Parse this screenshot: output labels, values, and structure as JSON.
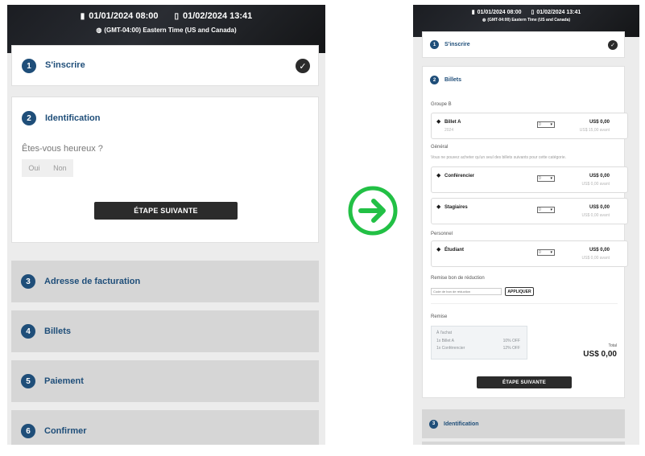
{
  "left": {
    "header": {
      "start_date": "01/01/2024 08:00",
      "end_date": "01/02/2024 13:41",
      "timezone": "(GMT-04:00) Eastern Time (US and Canada)"
    },
    "step1": {
      "number": "1",
      "title": "S'inscrire"
    },
    "step2": {
      "number": "2",
      "title": "Identification",
      "question": "Êtes-vous heureux ?",
      "option_yes": "Oui",
      "option_no": "Non",
      "next_button": "ÉTAPE SUIVANTE"
    },
    "collapsed_steps": [
      {
        "number": "3",
        "title": "Adresse de facturation"
      },
      {
        "number": "4",
        "title": "Billets"
      },
      {
        "number": "5",
        "title": "Paiement"
      },
      {
        "number": "6",
        "title": "Confirmer"
      }
    ]
  },
  "right": {
    "header": {
      "start_date": "01/01/2024 08:00",
      "end_date": "01/02/2024 13:41",
      "timezone": "(GMT-04:00) Eastern Time (US and Canada)"
    },
    "step1": {
      "number": "1",
      "title": "S'inscrire"
    },
    "step2": {
      "number": "2",
      "title": "Billets",
      "group_b": "Groupe B",
      "general": "Général",
      "general_note": "Vous ne pouvez acheter qu'un seul des billets suivants pour cette catégorie.",
      "personnel": "Personnel",
      "tickets": [
        {
          "name": "Billet A",
          "sub": "2024",
          "qty": "0",
          "price": "US$ 0,00",
          "price_sub": "US$ 15,00 avant"
        },
        {
          "name": "Conférencier",
          "sub": "",
          "qty": "0",
          "price": "US$ 0,00",
          "price_sub": "US$ 0,00 avant"
        },
        {
          "name": "Stagiaires",
          "sub": "",
          "qty": "0",
          "price": "US$ 0,00",
          "price_sub": "US$ 0,00 avant"
        },
        {
          "name": "Étudiant",
          "sub": "",
          "qty": "0",
          "price": "US$ 0,00",
          "price_sub": "US$ 0,00 avant"
        }
      ],
      "discount_label": "Remise bon de réduction",
      "discount_placeholder": "Code de bon de réduction",
      "apply_button": "APPLIQUER",
      "remise_label": "Remise",
      "remise_box": {
        "title": "À l'achat",
        "lines": [
          {
            "label": "1x Billet A",
            "value": "10% OFF"
          },
          {
            "label": "1x Conférencier",
            "value": "12% OFF"
          }
        ]
      },
      "total_label": "Total",
      "total_value": "US$ 0,00",
      "next_button": "ÉTAPE SUIVANTE"
    },
    "step3": {
      "number": "3",
      "title": "Identification"
    }
  },
  "colors": {
    "brand_blue": "#1f4e79",
    "dark_button": "#2b2b2b",
    "arrow_green": "#22c045",
    "collapsed_step_bg": "#d6d6d6"
  },
  "icons": [
    "calendar-icon",
    "globe-icon",
    "check-icon",
    "arrow-right-circle-icon",
    "ticket-icon"
  ]
}
